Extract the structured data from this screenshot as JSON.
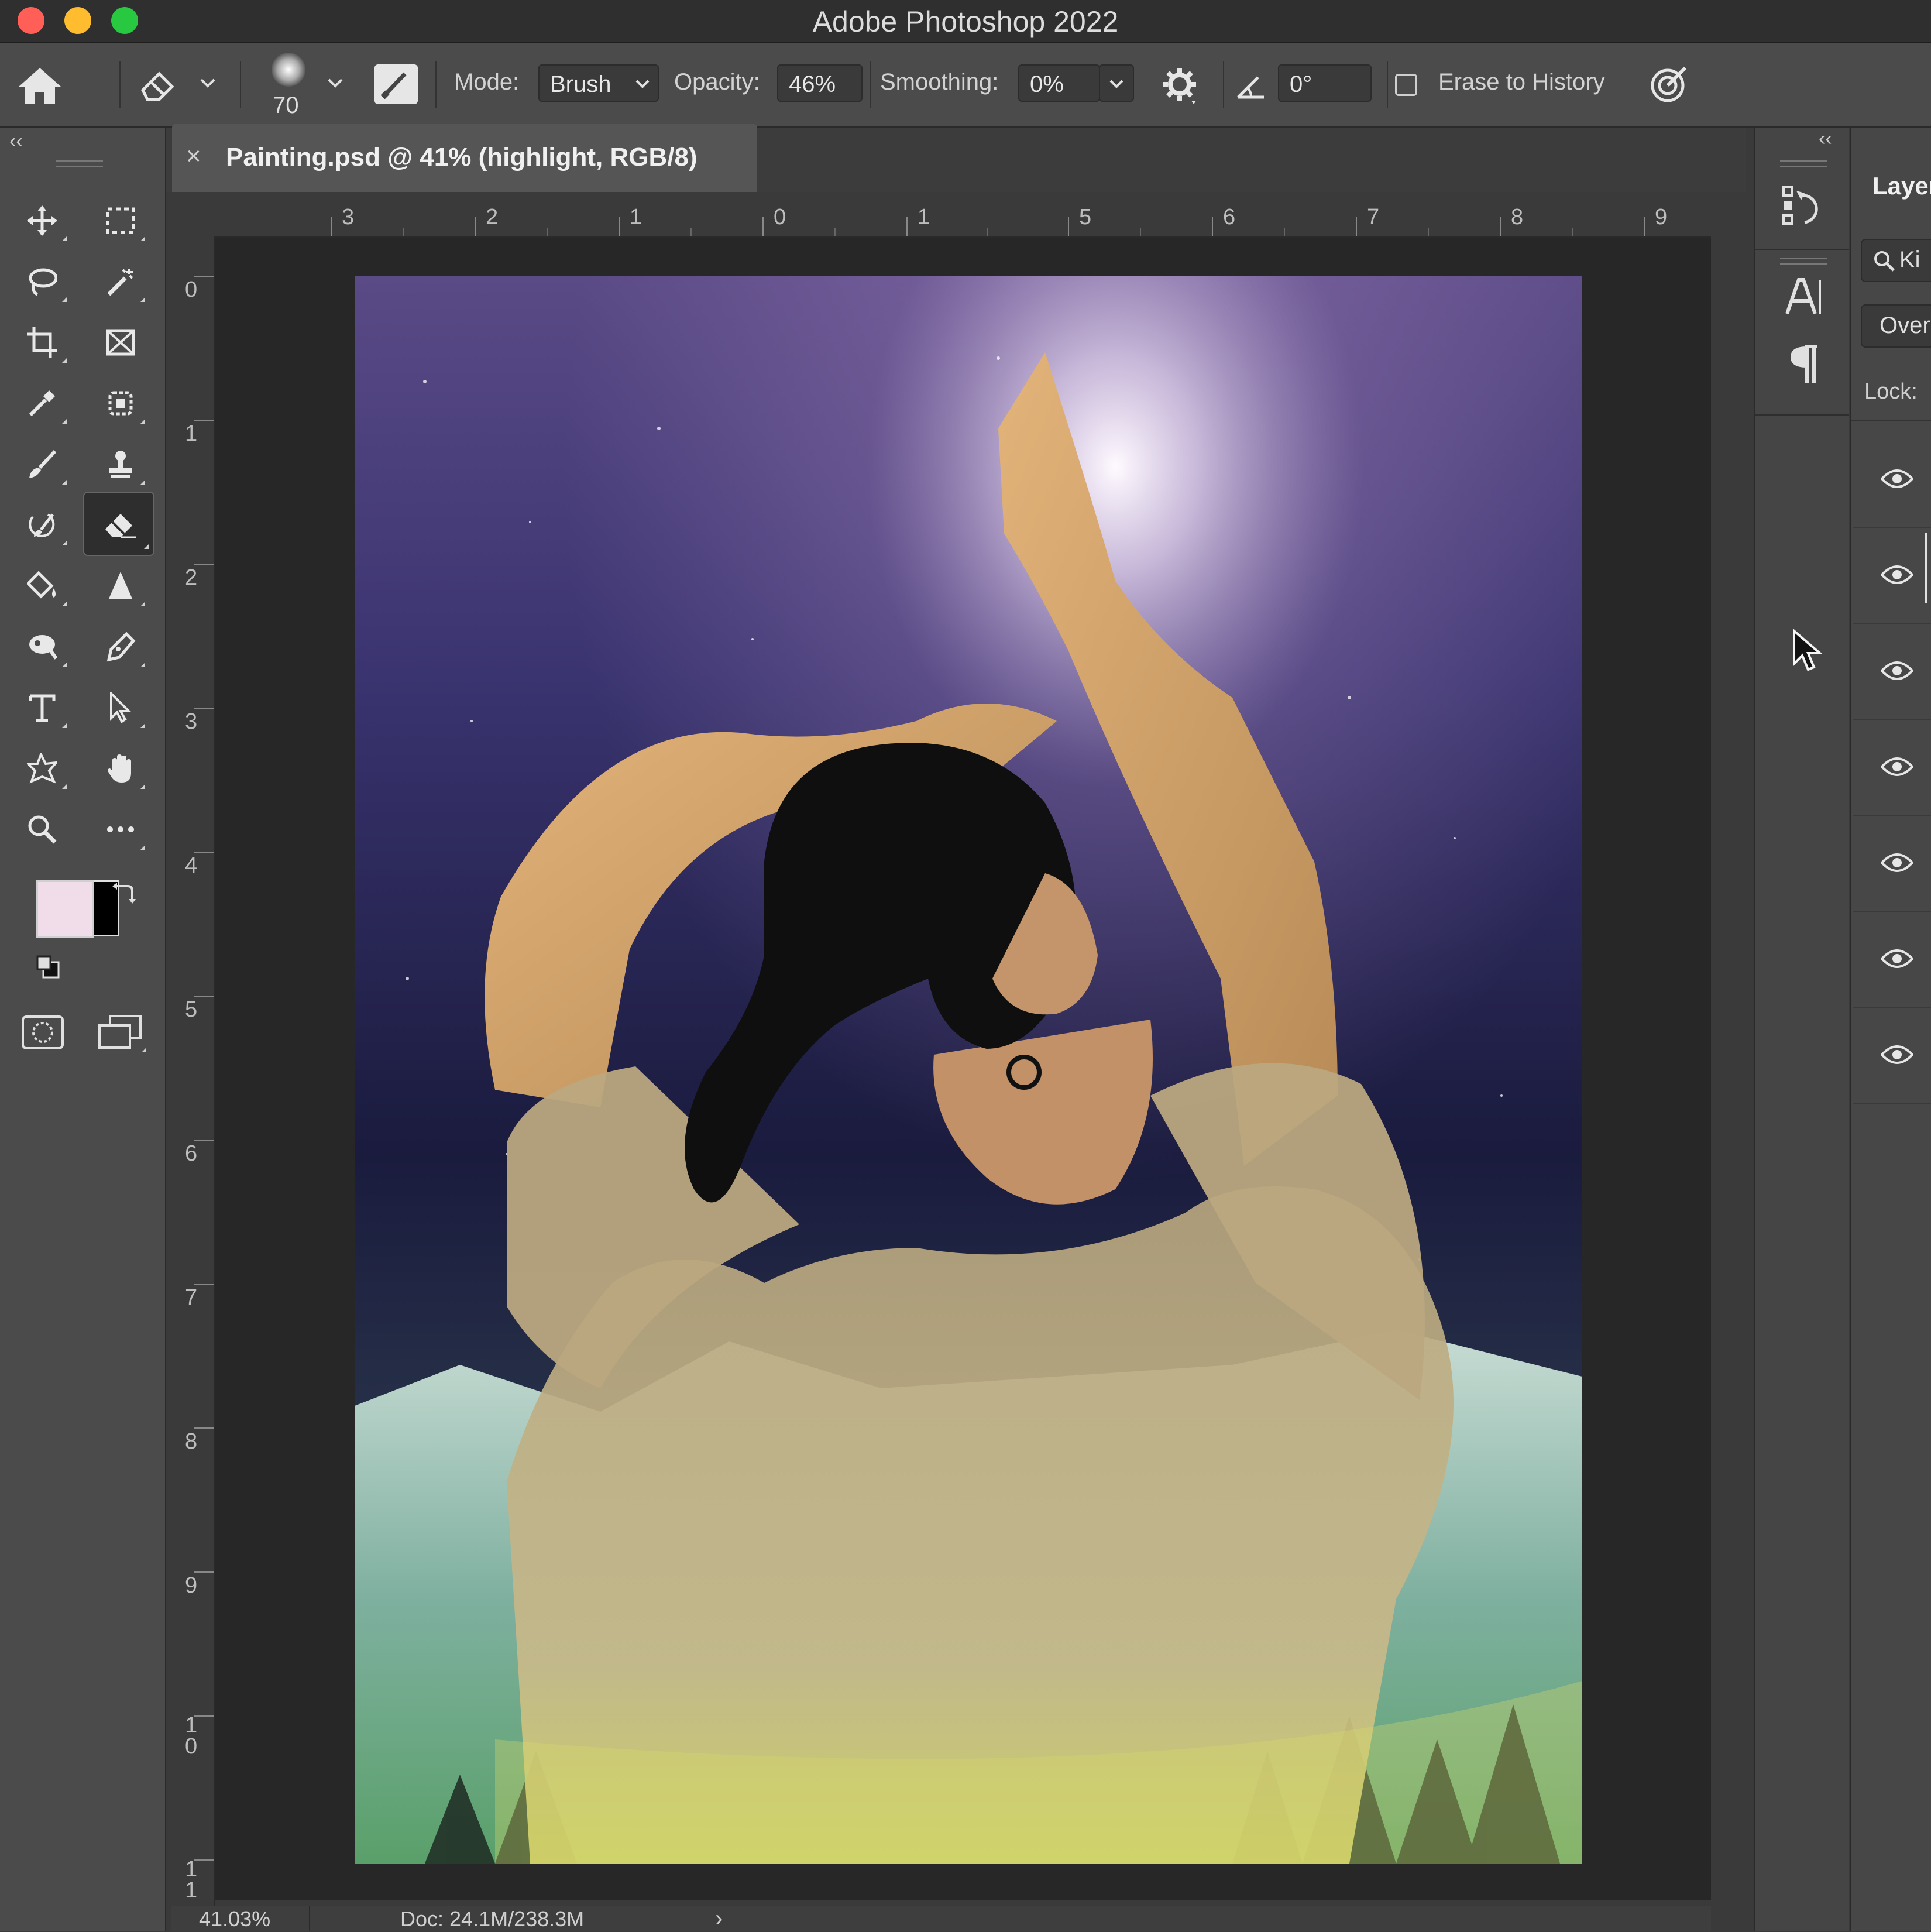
{
  "window": {
    "title": "Adobe Photoshop 2022",
    "traffic_lights": [
      "#ff5f57",
      "#febc2e",
      "#28c840"
    ]
  },
  "options_bar": {
    "home_icon": "home-icon",
    "tool_icon": "eraser-icon",
    "brush_size": "70",
    "mode_label": "Mode:",
    "mode_value": "Brush",
    "opacity_label": "Opacity:",
    "opacity_value": "46%",
    "smoothing_label": "Smoothing:",
    "smoothing_value": "0%",
    "angle_value": "0°",
    "erase_to_history_label": "Erase to History",
    "erase_to_history_checked": false
  },
  "document": {
    "tab_title": "Painting.psd @ 41% (highlight, RGB/8)",
    "close_glyph": "×",
    "ruler_top": [
      "3",
      "2",
      "1",
      "0",
      "1",
      "5",
      "6",
      "7",
      "8",
      "9"
    ],
    "ruler_left": [
      "0",
      "1",
      "2",
      "3",
      "4",
      "5",
      "6",
      "7",
      "8",
      "9",
      "1\n0",
      "1\n1"
    ],
    "zoom": "41.03%",
    "doc_size": "Doc: 24.1M/238.3M",
    "status_arrow": "›"
  },
  "colors": {
    "foreground": "#f1dcea",
    "background": "#000000",
    "app_bg": "#3a3a3a",
    "panel_bg": "#4b4b4b"
  },
  "tools": [
    {
      "name": "move-tool",
      "icon": "move-icon"
    },
    {
      "name": "marquee-tool",
      "icon": "rect-marquee-icon"
    },
    {
      "name": "lasso-tool",
      "icon": "lasso-icon"
    },
    {
      "name": "magic-wand-tool",
      "icon": "magic-wand-icon"
    },
    {
      "name": "crop-tool",
      "icon": "crop-icon"
    },
    {
      "name": "frame-tool",
      "icon": "frame-icon"
    },
    {
      "name": "eyedropper-tool",
      "icon": "eyedropper-icon"
    },
    {
      "name": "healing-tool",
      "icon": "healing-icon"
    },
    {
      "name": "brush-tool",
      "icon": "brush-icon"
    },
    {
      "name": "stamp-tool",
      "icon": "stamp-icon"
    },
    {
      "name": "history-brush-tool",
      "icon": "history-brush-icon"
    },
    {
      "name": "eraser-tool",
      "icon": "eraser-icon",
      "active": true
    },
    {
      "name": "paint-bucket-tool",
      "icon": "paint-bucket-icon"
    },
    {
      "name": "sharpen-tool",
      "icon": "triangle-icon"
    },
    {
      "name": "dodge-tool",
      "icon": "dodge-icon"
    },
    {
      "name": "pen-tool",
      "icon": "pen-icon"
    },
    {
      "name": "type-tool",
      "icon": "type-icon"
    },
    {
      "name": "path-select-tool",
      "icon": "arrow-icon"
    },
    {
      "name": "shape-tool",
      "icon": "shape-icon"
    },
    {
      "name": "hand-tool",
      "icon": "hand-icon"
    },
    {
      "name": "zoom-tool",
      "icon": "zoom-icon"
    },
    {
      "name": "more-tools",
      "icon": "ellipsis-icon"
    }
  ],
  "right_panel": {
    "layers_tab_label": "Layer",
    "search_text": "Ki",
    "blend_mode": "Over",
    "lock_label": "Lock:",
    "layer_visibility_rows": 7
  }
}
